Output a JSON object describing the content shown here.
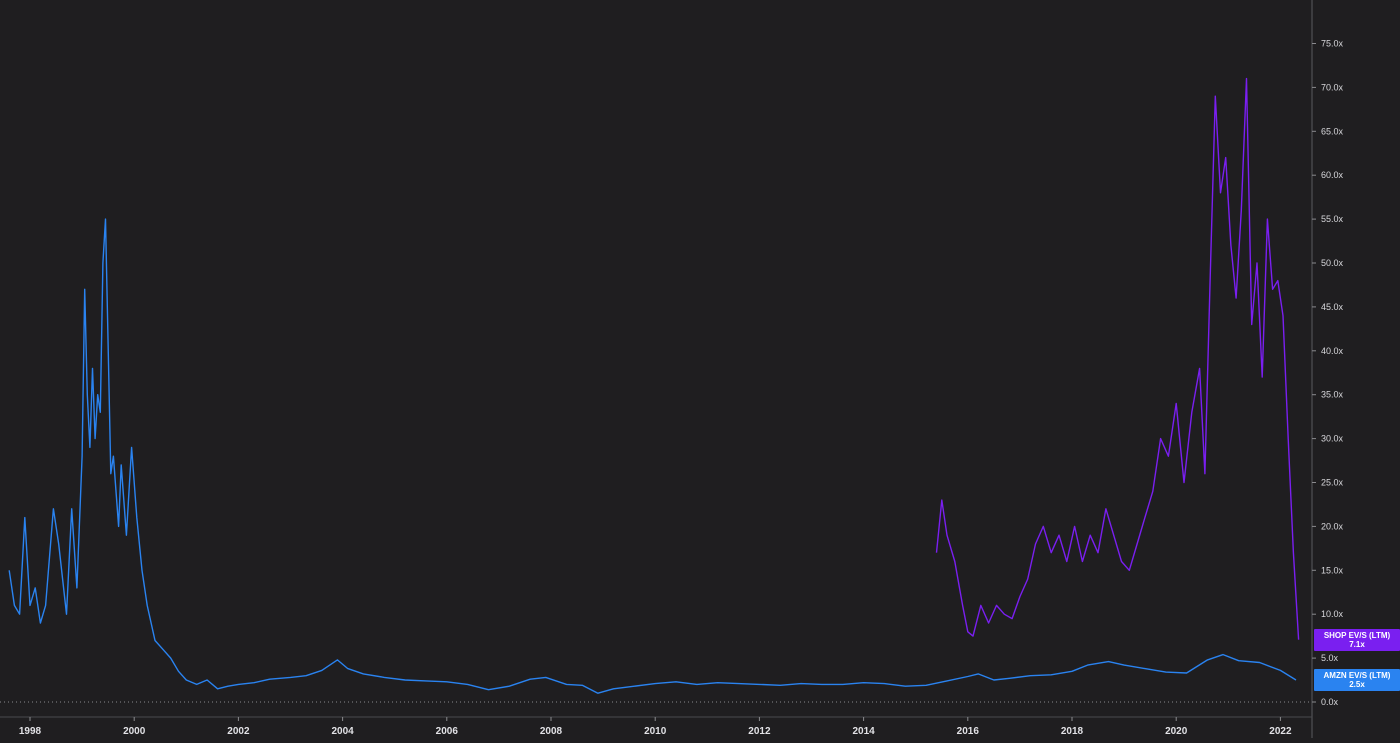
{
  "chart_data": {
    "type": "line",
    "title": "",
    "xlabel": "",
    "ylabel": "",
    "xlim": [
      1997.6,
      2022.7
    ],
    "ylim": [
      0,
      80
    ],
    "x_ticks": [
      "1998",
      "2000",
      "2002",
      "2004",
      "2006",
      "2008",
      "2010",
      "2012",
      "2014",
      "2016",
      "2018",
      "2020",
      "2022"
    ],
    "y_ticks": [
      "0.0x",
      "5.0x",
      "10.0x",
      "15.0x",
      "20.0x",
      "25.0x",
      "30.0x",
      "35.0x",
      "40.0x",
      "45.0x",
      "50.0x",
      "55.0x",
      "60.0x",
      "65.0x",
      "70.0x",
      "75.0x"
    ],
    "grid": false,
    "series": [
      {
        "name": "SHOP EV/S (LTM)",
        "label_value": "7.1x",
        "color": "#7a1ff0",
        "x": [
          2015.4,
          2015.5,
          2015.6,
          2015.75,
          2015.9,
          2016.0,
          2016.1,
          2016.25,
          2016.4,
          2016.55,
          2016.7,
          2016.85,
          2017.0,
          2017.15,
          2017.3,
          2017.45,
          2017.6,
          2017.75,
          2017.9,
          2018.05,
          2018.2,
          2018.35,
          2018.5,
          2018.65,
          2018.8,
          2018.95,
          2019.1,
          2019.25,
          2019.4,
          2019.55,
          2019.7,
          2019.85,
          2020.0,
          2020.15,
          2020.3,
          2020.45,
          2020.55,
          2020.65,
          2020.75,
          2020.85,
          2020.95,
          2021.05,
          2021.15,
          2021.25,
          2021.35,
          2021.45,
          2021.55,
          2021.65,
          2021.75,
          2021.85,
          2021.95,
          2022.05,
          2022.15,
          2022.25,
          2022.35
        ],
        "values": [
          17,
          23,
          19,
          16,
          11,
          8,
          7.5,
          11,
          9,
          11,
          10,
          9.5,
          12,
          14,
          18,
          20,
          17,
          19,
          16,
          20,
          16,
          19,
          17,
          22,
          19,
          16,
          15,
          18,
          21,
          24,
          30,
          28,
          34,
          25,
          33,
          38,
          26,
          48,
          69,
          58,
          62,
          52,
          46,
          56,
          71,
          43,
          50,
          37,
          55,
          47,
          48,
          44,
          30,
          17,
          7.1
        ]
      },
      {
        "name": "AMZN EV/S (LTM)",
        "label_value": "2.5x",
        "color": "#2a83f0",
        "x": [
          1997.6,
          1997.7,
          1997.8,
          1997.9,
          1998.0,
          1998.1,
          1998.2,
          1998.3,
          1998.45,
          1998.55,
          1998.7,
          1998.8,
          1998.9,
          1999.0,
          1999.05,
          1999.1,
          1999.15,
          1999.2,
          1999.25,
          1999.3,
          1999.35,
          1999.4,
          1999.45,
          1999.55,
          1999.6,
          1999.7,
          1999.75,
          1999.85,
          1999.95,
          2000.05,
          2000.15,
          2000.25,
          2000.4,
          2000.55,
          2000.7,
          2000.85,
          2001.0,
          2001.2,
          2001.4,
          2001.6,
          2001.8,
          2002.0,
          2002.3,
          2002.6,
          2003.0,
          2003.3,
          2003.6,
          2003.9,
          2004.1,
          2004.4,
          2004.8,
          2005.2,
          2005.6,
          2006.0,
          2006.4,
          2006.8,
          2007.2,
          2007.6,
          2007.9,
          2008.3,
          2008.6,
          2008.9,
          2009.2,
          2009.6,
          2010.0,
          2010.4,
          2010.8,
          2011.2,
          2011.6,
          2012.0,
          2012.4,
          2012.8,
          2013.2,
          2013.6,
          2014.0,
          2014.4,
          2014.8,
          2015.2,
          2015.6,
          2016.0,
          2016.2,
          2016.5,
          2016.8,
          2017.2,
          2017.6,
          2018.0,
          2018.3,
          2018.7,
          2019.0,
          2019.4,
          2019.8,
          2020.2,
          2020.6,
          2020.9,
          2021.2,
          2021.6,
          2022.0,
          2022.3
        ],
        "values": [
          15,
          11,
          10,
          21,
          11,
          13,
          9,
          11,
          22,
          18,
          10,
          22,
          13,
          28,
          47,
          35,
          29,
          38,
          30,
          35,
          33,
          50,
          55,
          26,
          28,
          20,
          27,
          19,
          29,
          21,
          15,
          11,
          7,
          6,
          5,
          3.5,
          2.5,
          2,
          2.5,
          1.5,
          1.8,
          2,
          2.2,
          2.6,
          2.8,
          3.0,
          3.6,
          4.8,
          3.8,
          3.2,
          2.8,
          2.5,
          2.4,
          2.3,
          2.0,
          1.4,
          1.8,
          2.6,
          2.8,
          2.0,
          1.9,
          1.0,
          1.5,
          1.8,
          2.1,
          2.3,
          2.0,
          2.2,
          2.1,
          2.0,
          1.9,
          2.1,
          2.0,
          2.0,
          2.2,
          2.1,
          1.8,
          1.9,
          2.4,
          2.9,
          3.2,
          2.5,
          2.7,
          3.0,
          3.1,
          3.5,
          4.2,
          4.6,
          4.2,
          3.8,
          3.4,
          3.3,
          4.8,
          5.4,
          4.7,
          4.5,
          3.6,
          2.5
        ]
      }
    ]
  }
}
